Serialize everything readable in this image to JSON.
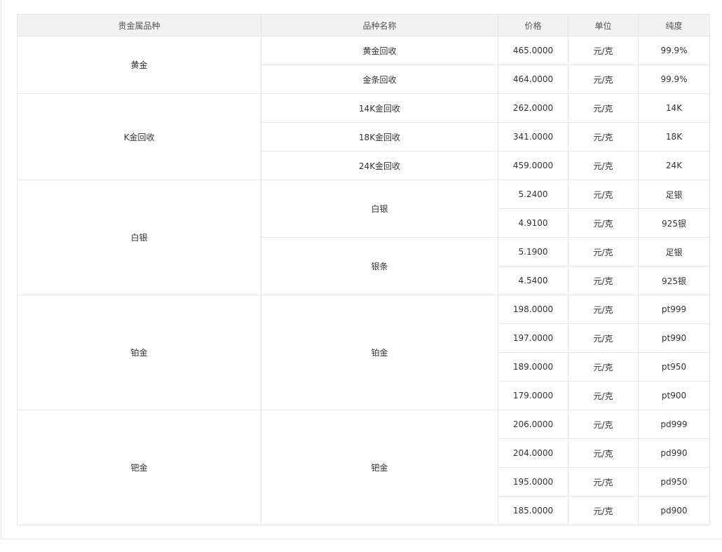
{
  "table": {
    "headers": [
      "贵金属品种",
      "品种名称",
      "价格",
      "单位",
      "纯度"
    ],
    "groups": [
      {
        "category": "黄金",
        "names": [
          {
            "name": "黄金回收",
            "rows": [
              {
                "price": "465.0000",
                "unit": "元/克",
                "purity": "99.9%"
              }
            ]
          },
          {
            "name": "金条回收",
            "rows": [
              {
                "price": "464.0000",
                "unit": "元/克",
                "purity": "99.9%"
              }
            ]
          }
        ]
      },
      {
        "category": "K金回收",
        "names": [
          {
            "name": "14K金回收",
            "rows": [
              {
                "price": "262.0000",
                "unit": "元/克",
                "purity": "14K"
              }
            ]
          },
          {
            "name": "18K金回收",
            "rows": [
              {
                "price": "341.0000",
                "unit": "元/克",
                "purity": "18K"
              }
            ]
          },
          {
            "name": "24K金回收",
            "rows": [
              {
                "price": "459.0000",
                "unit": "元/克",
                "purity": "24K"
              }
            ]
          }
        ]
      },
      {
        "category": "白银",
        "names": [
          {
            "name": "白银",
            "rows": [
              {
                "price": "5.2400",
                "unit": "元/克",
                "purity": "足银"
              },
              {
                "price": "4.9100",
                "unit": "元/克",
                "purity": "925银"
              }
            ]
          },
          {
            "name": "银条",
            "rows": [
              {
                "price": "5.1900",
                "unit": "元/克",
                "purity": "足银"
              },
              {
                "price": "4.5400",
                "unit": "元/克",
                "purity": "925银"
              }
            ]
          }
        ]
      },
      {
        "category": "铂金",
        "names": [
          {
            "name": "铂金",
            "rows": [
              {
                "price": "198.0000",
                "unit": "元/克",
                "purity": "pt999"
              },
              {
                "price": "197.0000",
                "unit": "元/克",
                "purity": "pt990"
              },
              {
                "price": "189.0000",
                "unit": "元/克",
                "purity": "pt950"
              },
              {
                "price": "179.0000",
                "unit": "元/克",
                "purity": "pt900"
              }
            ]
          }
        ]
      },
      {
        "category": "钯金",
        "names": [
          {
            "name": "钯金",
            "rows": [
              {
                "price": "206.0000",
                "unit": "元/克",
                "purity": "pd999"
              },
              {
                "price": "204.0000",
                "unit": "元/克",
                "purity": "pd990"
              },
              {
                "price": "195.0000",
                "unit": "元/克",
                "purity": "pd950"
              },
              {
                "price": "185.0000",
                "unit": "元/克",
                "purity": "pd900"
              }
            ]
          }
        ]
      }
    ]
  }
}
